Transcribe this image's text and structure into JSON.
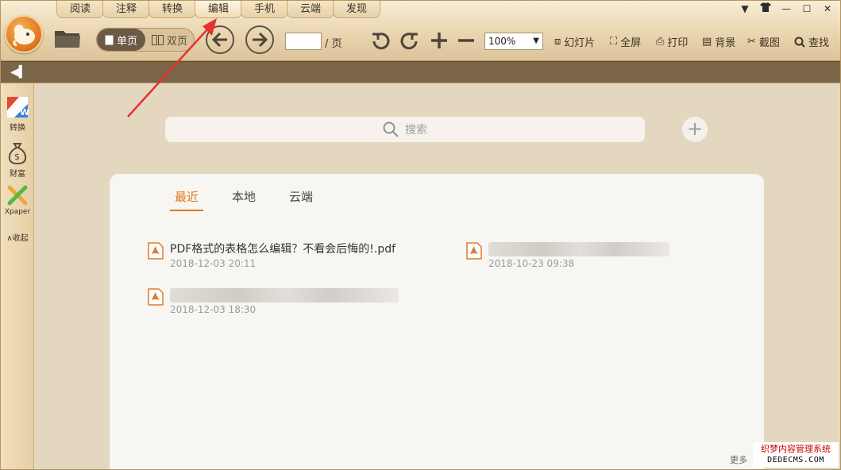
{
  "tabs": [
    {
      "label": "阅读"
    },
    {
      "label": "注释"
    },
    {
      "label": "转换"
    },
    {
      "label": "编辑"
    },
    {
      "label": "手机"
    },
    {
      "label": "云端"
    },
    {
      "label": "发现"
    }
  ],
  "toolbar": {
    "single_page": "单页",
    "double_page": "双页",
    "page_separator": "/ 页",
    "zoom": "100%",
    "slideshow": "幻灯片",
    "fullscreen": "全屏",
    "print": "打印",
    "background": "背景",
    "screenshot": "截图",
    "find": "查找"
  },
  "sidebar": {
    "convert": "转换",
    "wealth": "财富",
    "xpaper": "Xpaper",
    "collapse": "∧收起"
  },
  "search": {
    "placeholder": "搜索"
  },
  "panel": {
    "tabs": [
      {
        "label": "最近"
      },
      {
        "label": "本地"
      },
      {
        "label": "云端"
      }
    ]
  },
  "files": [
    {
      "name": "PDF格式的表格怎么编辑？不看会后悔的!.pdf",
      "date": "2018-12-03 20:11"
    },
    {
      "name": "",
      "date": "2018-10-23 09:38"
    },
    {
      "name": "",
      "date": "2018-12-03 18:30"
    }
  ],
  "footer": {
    "more": "更多"
  },
  "watermark": {
    "line1": "织梦内容管理系统",
    "line2": "DEDECMS.COM"
  },
  "colors": {
    "accent": "#e2761c",
    "annotation": "#e8302c"
  }
}
